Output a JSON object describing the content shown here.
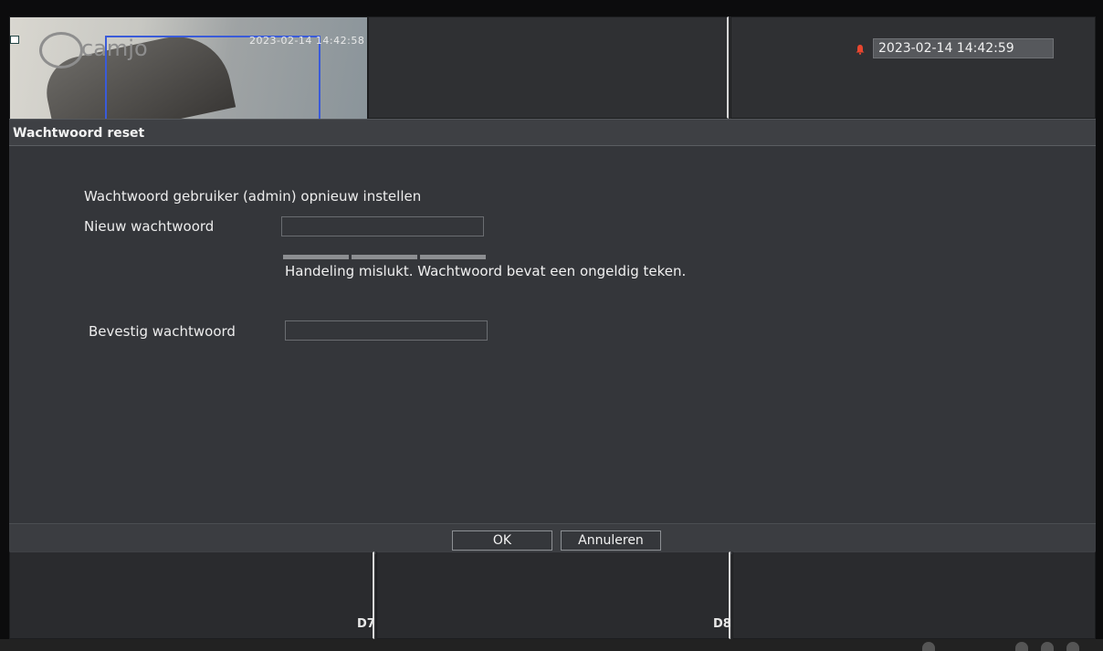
{
  "camera": {
    "logo_text": "camjo",
    "overlay_timestamp": "2023-02-14 14:42:58"
  },
  "status_bar": {
    "datetime": "2023-02-14 14:42:59",
    "alarm_icon": "bell-alarm-icon",
    "alarm_color": "#e8462f"
  },
  "dialog": {
    "title": "Wachtwoord reset",
    "subtitle": "Wachtwoord gebruiker (admin) opnieuw instellen",
    "new_password_label": "Nieuw wachtwoord",
    "new_password_value": "",
    "error_message": "Handeling mislukt. Wachtwoord bevat een ongeldig teken.",
    "confirm_password_label": "Bevestig wachtwoord",
    "confirm_password_value": ""
  },
  "buttons": {
    "ok_label": "OK",
    "cancel_label": "Annuleren"
  },
  "channels": {
    "bottom_left": "",
    "bottom_middle": "D7",
    "bottom_right": "D8"
  }
}
